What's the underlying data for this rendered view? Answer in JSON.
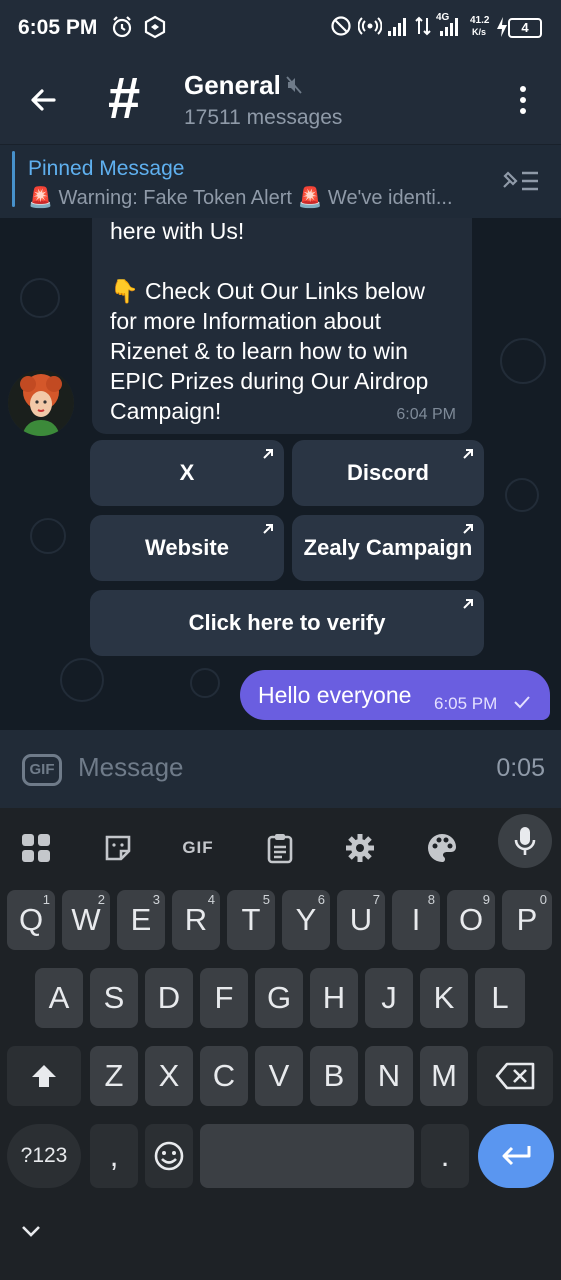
{
  "status_bar": {
    "time": "6:05 PM",
    "net_speed_value": "41.2",
    "net_speed_unit": "K/s",
    "net_type": "4G",
    "battery": "4"
  },
  "header": {
    "channel_icon": "#",
    "title": "General",
    "subtitle": "17511 messages"
  },
  "pinned": {
    "title": "Pinned Message",
    "text": "🚨 Warning: Fake Token Alert 🚨  We've identi..."
  },
  "message": {
    "lines": [
      "here with Us!",
      "",
      "👇 Check Out Our Links below",
      "for more Information about",
      "Rizenet & to learn how to win",
      "EPIC Prizes during Our Airdrop",
      "Campaign!"
    ],
    "time": "6:04 PM"
  },
  "inline_buttons": {
    "x": "X",
    "discord": "Discord",
    "website": "Website",
    "zealy": "Zealy Campaign",
    "verify": "Click here to verify"
  },
  "outgoing": {
    "text": "Hello everyone",
    "time": "6:05 PM"
  },
  "input": {
    "gif_label": "GIF",
    "placeholder": "Message",
    "record_time": "0:05"
  },
  "keyboard": {
    "toolbar_gif": "GIF",
    "row1": [
      {
        "k": "Q",
        "n": "1"
      },
      {
        "k": "W",
        "n": "2"
      },
      {
        "k": "E",
        "n": "3"
      },
      {
        "k": "R",
        "n": "4"
      },
      {
        "k": "T",
        "n": "5"
      },
      {
        "k": "Y",
        "n": "6"
      },
      {
        "k": "U",
        "n": "7"
      },
      {
        "k": "I",
        "n": "8"
      },
      {
        "k": "O",
        "n": "9"
      },
      {
        "k": "P",
        "n": "0"
      }
    ],
    "row2": [
      "A",
      "S",
      "D",
      "F",
      "G",
      "H",
      "J",
      "K",
      "L"
    ],
    "row3": [
      "Z",
      "X",
      "C",
      "V",
      "B",
      "N",
      "M"
    ],
    "symbols": "?123",
    "comma": ",",
    "period": "."
  }
}
